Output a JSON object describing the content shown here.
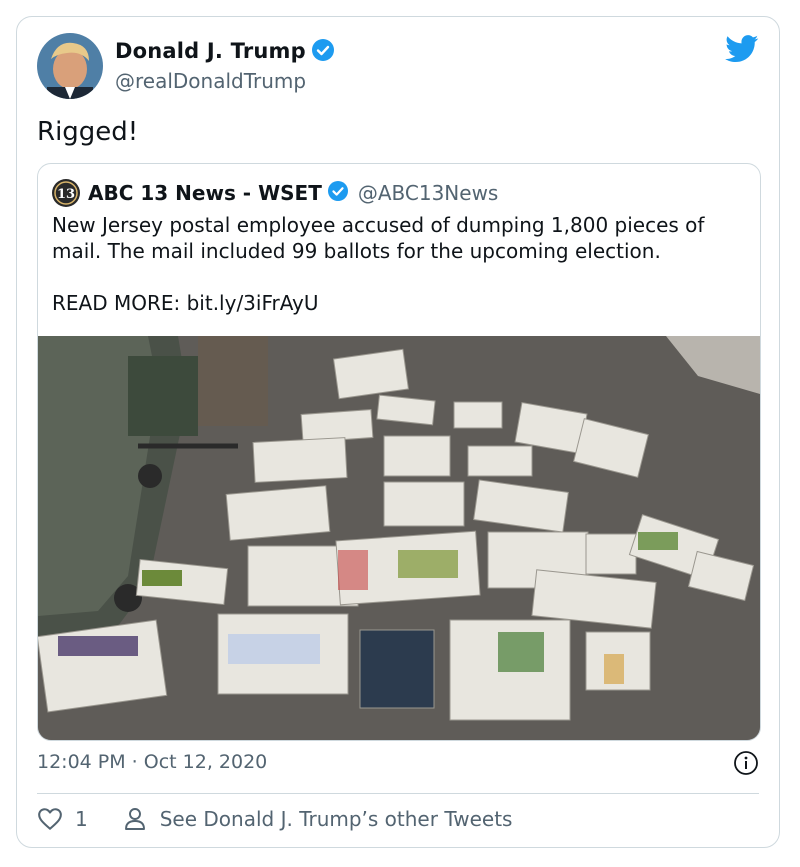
{
  "author": {
    "name": "Donald J. Trump",
    "handle": "@realDonaldTrump"
  },
  "tweet": {
    "text": "Rigged!",
    "timestamp": "12:04 PM · Oct 12, 2020"
  },
  "quoted": {
    "logo_text": "13",
    "name": "ABC 13 News - WSET",
    "handle": "@ABC13News",
    "line1": "New Jersey postal employee accused of dumping 1,800 pieces of",
    "line2": "mail. The mail included 99 ballots for the upcoming election.",
    "read_more": "READ MORE: bit.ly/3iFrAyU"
  },
  "actions": {
    "like_count": "1",
    "see_more": "See Donald J. Trump’s other Tweets"
  },
  "icons": {
    "verified": "verified-badge-icon",
    "bird": "twitter-bird-icon",
    "info": "info-icon",
    "heart": "heart-icon",
    "person": "person-icon"
  },
  "colors": {
    "verified_blue": "#1d9bf0",
    "secondary_text": "#536471",
    "border": "#cfd9de"
  }
}
